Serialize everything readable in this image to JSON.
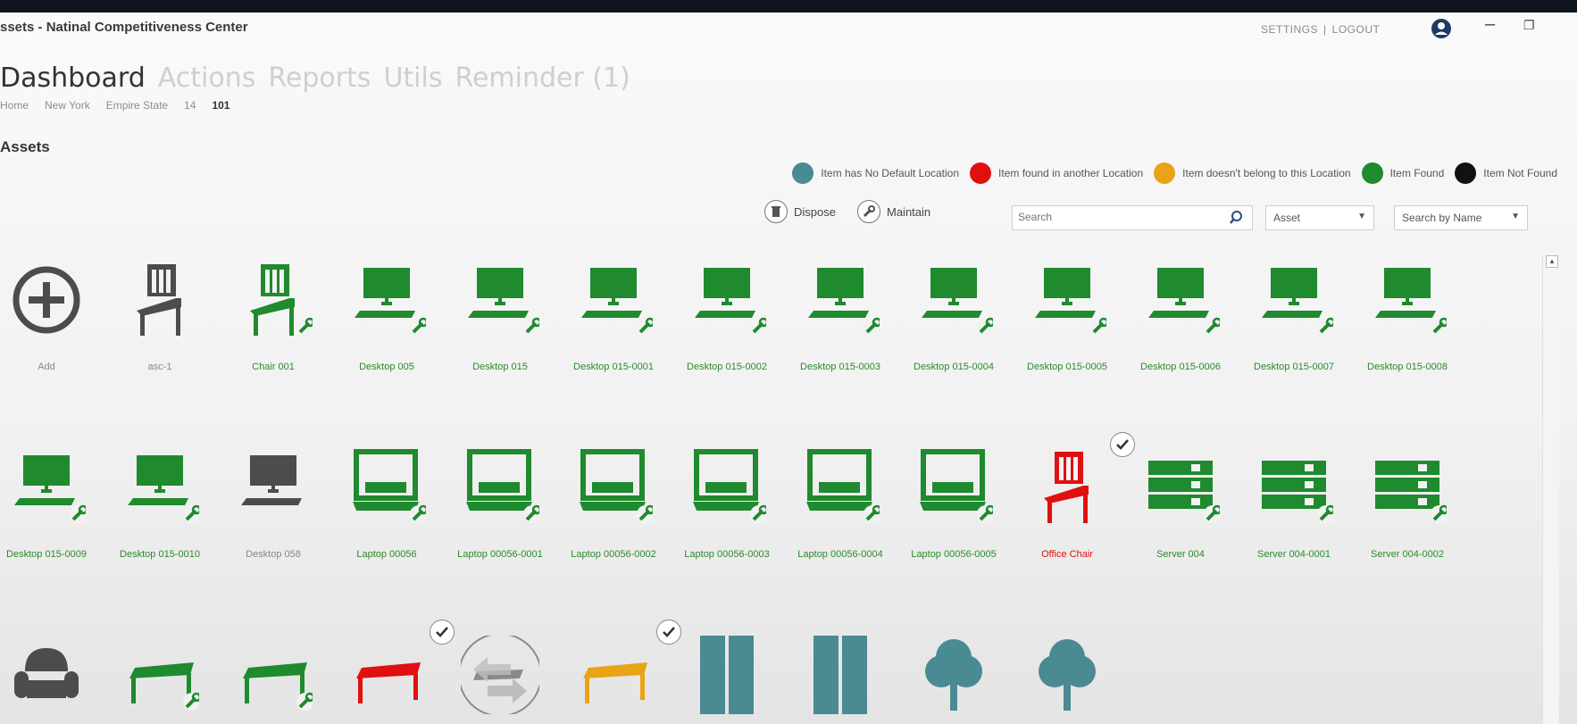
{
  "window": {
    "title": "ssets - Natinal Competitiveness Center",
    "links": [
      "SETTINGS",
      "LOGOUT"
    ],
    "sep": "|",
    "controls": [
      "minimize-icon",
      "restore-icon"
    ]
  },
  "nav": {
    "tabs": [
      "Dashboard",
      "Actions",
      "Reports",
      "Utils",
      "Reminder (1)"
    ],
    "active": "Dashboard"
  },
  "breadcrumb": [
    "Home",
    "New York",
    "Empire State",
    "14",
    "101"
  ],
  "section_title": "Assets",
  "legend": [
    {
      "label": "Item has No Default Location",
      "color": "#4a8a92"
    },
    {
      "label": "Item found in another Location",
      "color": "#e01010"
    },
    {
      "label": "Item doesn't belong to this Location",
      "color": "#e8a317"
    },
    {
      "label": "Item Found",
      "color": "#1f8a2e"
    },
    {
      "label": "Item Not Found",
      "color": "#111111"
    }
  ],
  "toolbar": {
    "dispose_label": "Dispose",
    "maintain_label": "Maintain",
    "search_placeholder": "Search",
    "type_select": "Asset",
    "search_mode_select": "Search by Name"
  },
  "colors": {
    "green": "#1f8a2e",
    "gray": "#4c4c4c",
    "red": "#e01010",
    "orange": "#e8a317",
    "teal": "#4a8a92"
  },
  "assets": [
    {
      "label": "Add",
      "icon": "add-circle-icon",
      "color": "gray",
      "row": 0,
      "col": 0
    },
    {
      "label": "asc-1",
      "icon": "chair-icon",
      "color": "gray",
      "row": 0,
      "col": 1
    },
    {
      "label": "Chair 001",
      "icon": "chair-icon",
      "color": "green",
      "row": 0,
      "col": 2,
      "wrench": true
    },
    {
      "label": "Desktop 005",
      "icon": "desktop-icon",
      "color": "green",
      "row": 0,
      "col": 3,
      "wrench": true
    },
    {
      "label": "Desktop 015",
      "icon": "desktop-icon",
      "color": "green",
      "row": 0,
      "col": 4,
      "wrench": true
    },
    {
      "label": "Desktop 015-0001",
      "icon": "desktop-icon",
      "color": "green",
      "row": 0,
      "col": 5,
      "wrench": true
    },
    {
      "label": "Desktop 015-0002",
      "icon": "desktop-icon",
      "color": "green",
      "row": 0,
      "col": 6,
      "wrench": true
    },
    {
      "label": "Desktop 015-0003",
      "icon": "desktop-icon",
      "color": "green",
      "row": 0,
      "col": 7,
      "wrench": true
    },
    {
      "label": "Desktop 015-0004",
      "icon": "desktop-icon",
      "color": "green",
      "row": 0,
      "col": 8,
      "wrench": true
    },
    {
      "label": "Desktop 015-0005",
      "icon": "desktop-icon",
      "color": "green",
      "row": 0,
      "col": 9,
      "wrench": true
    },
    {
      "label": "Desktop 015-0006",
      "icon": "desktop-icon",
      "color": "green",
      "row": 0,
      "col": 10,
      "wrench": true
    },
    {
      "label": "Desktop 015-0007",
      "icon": "desktop-icon",
      "color": "green",
      "row": 0,
      "col": 11,
      "wrench": true
    },
    {
      "label": "Desktop 015-0008",
      "icon": "desktop-icon",
      "color": "green",
      "row": 0,
      "col": 12,
      "wrench": true
    },
    {
      "label": "Desktop 015-0009",
      "icon": "desktop-icon",
      "color": "green",
      "row": 1,
      "col": 0,
      "wrench": true
    },
    {
      "label": "Desktop 015-0010",
      "icon": "desktop-icon",
      "color": "green",
      "row": 1,
      "col": 1,
      "wrench": true
    },
    {
      "label": "Desktop 058",
      "icon": "desktop-icon",
      "color": "gray",
      "row": 1,
      "col": 2
    },
    {
      "label": "Laptop 00056",
      "icon": "laptop-icon",
      "color": "green",
      "row": 1,
      "col": 3,
      "wrench": true
    },
    {
      "label": "Laptop 00056-0001",
      "icon": "laptop-icon",
      "color": "green",
      "row": 1,
      "col": 4,
      "wrench": true
    },
    {
      "label": "Laptop 00056-0002",
      "icon": "laptop-icon",
      "color": "green",
      "row": 1,
      "col": 5,
      "wrench": true
    },
    {
      "label": "Laptop 00056-0003",
      "icon": "laptop-icon",
      "color": "green",
      "row": 1,
      "col": 6,
      "wrench": true
    },
    {
      "label": "Laptop 00056-0004",
      "icon": "laptop-icon",
      "color": "green",
      "row": 1,
      "col": 7,
      "wrench": true
    },
    {
      "label": "Laptop 00056-0005",
      "icon": "laptop-icon",
      "color": "green",
      "row": 1,
      "col": 8,
      "wrench": true
    },
    {
      "label": "Office Chair",
      "icon": "chair-icon",
      "color": "red",
      "row": 1,
      "col": 9,
      "checked": true
    },
    {
      "label": "Server 004",
      "icon": "server-icon",
      "color": "green",
      "row": 1,
      "col": 10,
      "wrench": true
    },
    {
      "label": "Server 004-0001",
      "icon": "server-icon",
      "color": "green",
      "row": 1,
      "col": 11,
      "wrench": true
    },
    {
      "label": "Server 004-0002",
      "icon": "server-icon",
      "color": "green",
      "row": 1,
      "col": 12,
      "wrench": true
    },
    {
      "label": "",
      "icon": "armchair-icon",
      "color": "gray",
      "row": 2,
      "col": 0
    },
    {
      "label": "",
      "icon": "table-icon",
      "color": "green",
      "row": 2,
      "col": 1,
      "wrench": true
    },
    {
      "label": "",
      "icon": "table-icon",
      "color": "green",
      "row": 2,
      "col": 2,
      "wrench": true
    },
    {
      "label": "",
      "icon": "table-icon",
      "color": "red",
      "row": 2,
      "col": 3,
      "checked": true
    },
    {
      "label": "",
      "icon": "transfer-icon",
      "color": "gray",
      "row": 2,
      "col": 4
    },
    {
      "label": "",
      "icon": "table-icon",
      "color": "orange",
      "row": 2,
      "col": 5,
      "checked": true
    },
    {
      "label": "",
      "icon": "cabinet-icon",
      "color": "teal",
      "row": 2,
      "col": 6
    },
    {
      "label": "",
      "icon": "cabinet-icon",
      "color": "teal",
      "row": 2,
      "col": 7
    },
    {
      "label": "",
      "icon": "tree-icon",
      "color": "teal",
      "row": 2,
      "col": 8
    },
    {
      "label": "",
      "icon": "tree-icon",
      "color": "teal",
      "row": 2,
      "col": 9
    }
  ]
}
